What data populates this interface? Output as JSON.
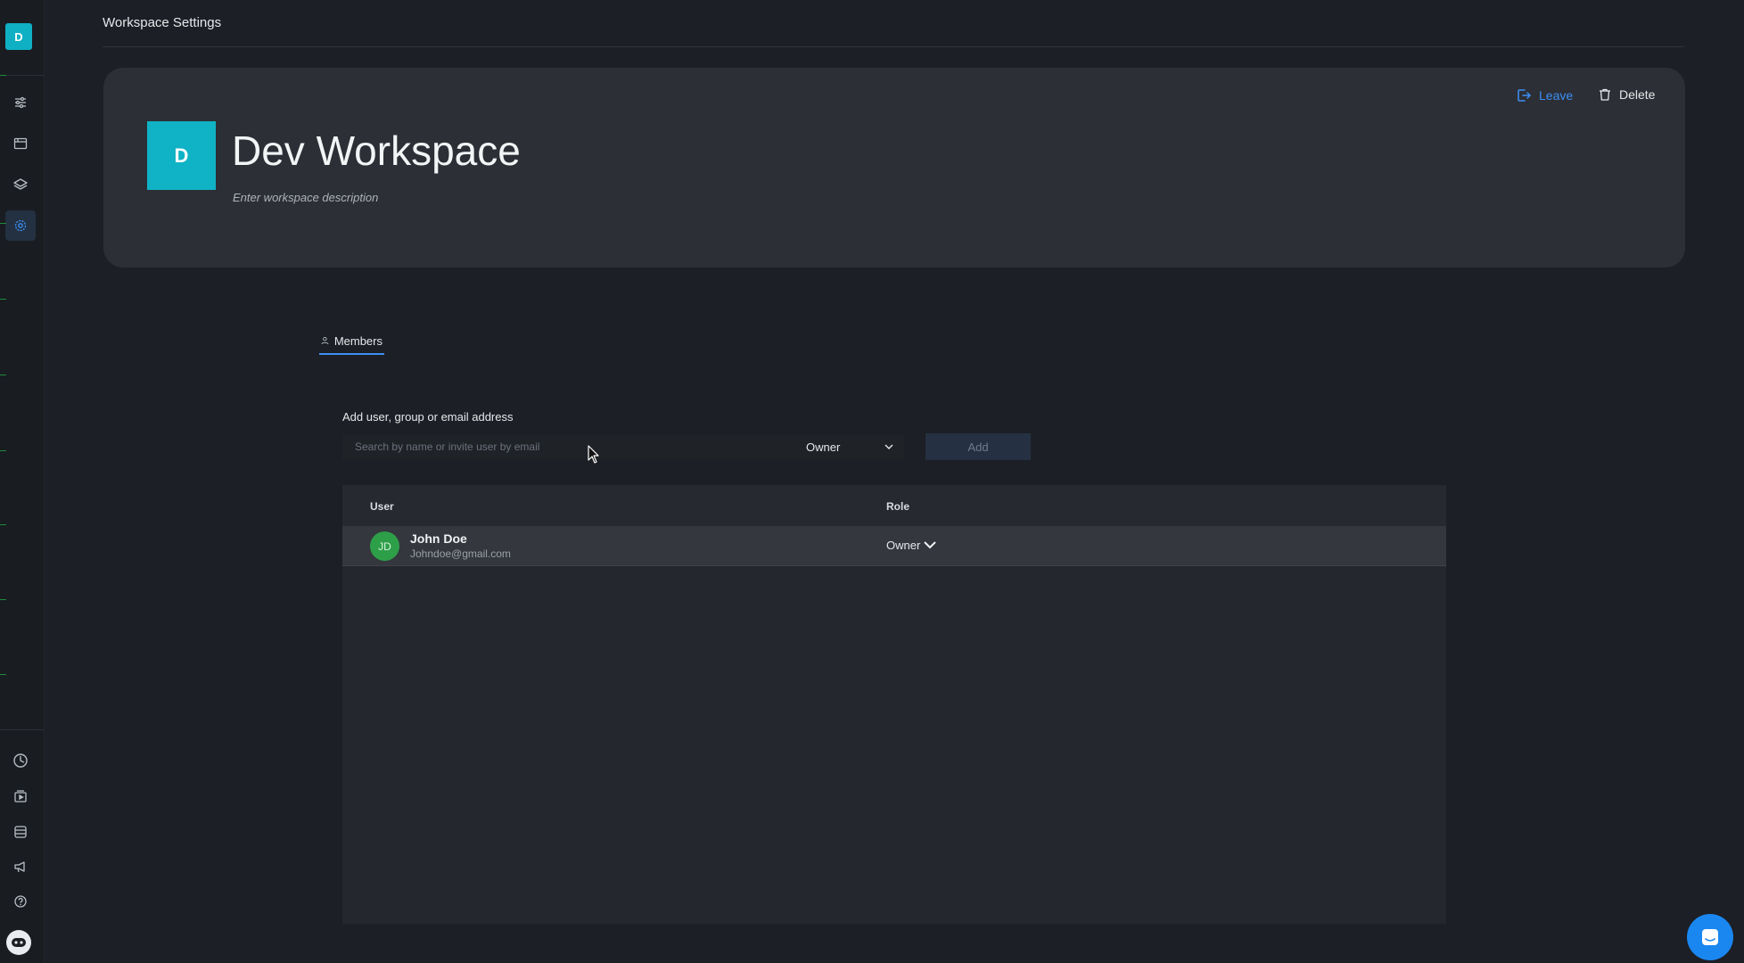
{
  "rail": {
    "workspace_initial": "D",
    "top_icons": [
      "sliders-icon",
      "browser-window-icon",
      "layers-icon",
      "settings-gear-icon"
    ],
    "bottom_icons": [
      "clock-icon",
      "media-library-icon",
      "database-icon",
      "megaphone-icon",
      "help-icon",
      "user-avatar-icon"
    ],
    "active_item": "settings-gear-icon"
  },
  "header": {
    "title": "Workspace Settings"
  },
  "workspace": {
    "initial": "D",
    "name": "Dev Workspace",
    "description_placeholder": "Enter workspace description",
    "leave_label": "Leave",
    "delete_label": "Delete"
  },
  "tabs": {
    "members_label": "Members"
  },
  "invite": {
    "label": "Add user, group or email address",
    "search_placeholder": "Search by name or invite user by email",
    "role_value": "Owner",
    "add_label": "Add"
  },
  "members_table": {
    "columns": [
      "User",
      "Role"
    ],
    "rows": [
      {
        "initials": "JD",
        "name": "John Doe",
        "email": "Johndoe@gmail.com",
        "role": "Owner"
      }
    ]
  },
  "colors": {
    "accent": "#3d8ff5",
    "workspace_badge": "#10b3c6",
    "member_avatar": "#2e9f49",
    "background": "#1c1f25"
  }
}
